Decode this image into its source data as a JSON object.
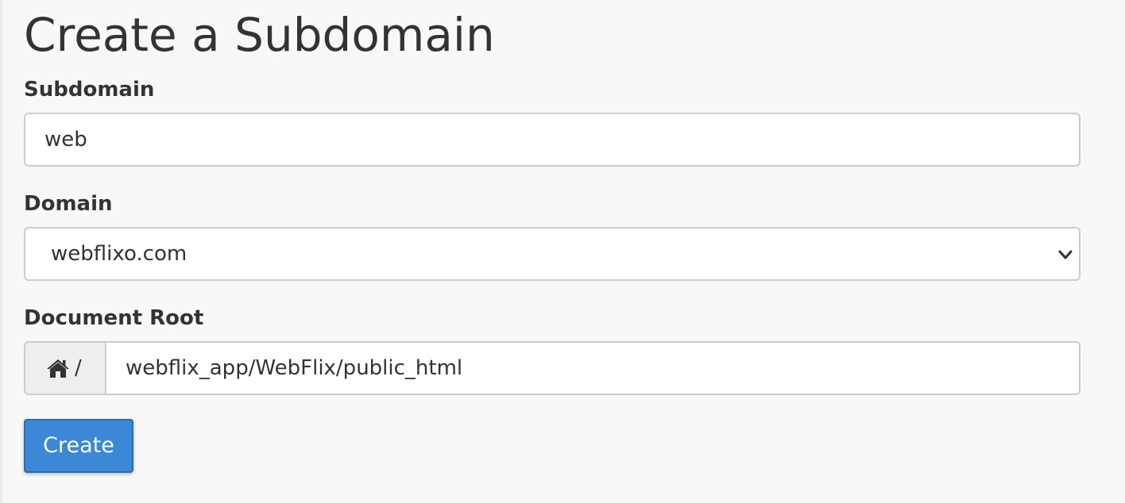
{
  "page": {
    "title": "Create a Subdomain"
  },
  "subdomain": {
    "label": "Subdomain",
    "value": "web"
  },
  "domain": {
    "label": "Domain",
    "selected": "webflixo.com"
  },
  "document_root": {
    "label": "Document Root",
    "prefix_icon": "home-icon",
    "prefix_text": "/",
    "value": "webflix_app/WebFlix/public_html"
  },
  "actions": {
    "create_label": "Create"
  },
  "colors": {
    "primary_button": "#3b89d6",
    "background": "#f8f8f8",
    "text": "#333333",
    "border": "#cccccc"
  }
}
